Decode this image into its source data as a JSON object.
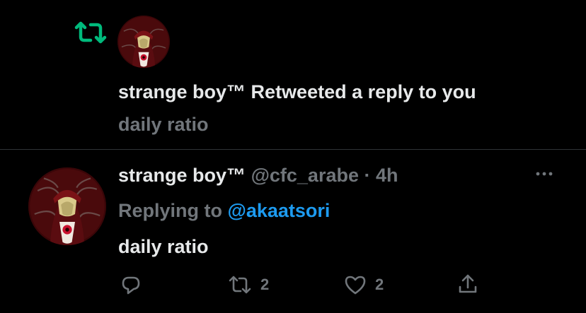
{
  "notification": {
    "icon": "retweet-icon",
    "accent": "#00ba7c",
    "actor_name": "strange boy™",
    "action_text": " Retweeted a reply to you",
    "preview_text": "daily ratio"
  },
  "tweet": {
    "display_name": "strange boy™",
    "handle": "@cfc_arabe",
    "separator": " · ",
    "time": "4h",
    "replying_prefix": "Replying to ",
    "replying_handle": "@akaatsori",
    "text": "daily ratio",
    "actions": {
      "reply_icon": "reply-icon",
      "retweet_icon": "retweet-icon",
      "retweet_count": "2",
      "like_icon": "heart-icon",
      "like_count": "2",
      "share_icon": "share-icon"
    }
  },
  "colors": {
    "background": "#000000",
    "text_primary": "#e7e9ea",
    "text_secondary": "#71767b",
    "link": "#1d9bf0",
    "divider": "#2f3336"
  }
}
